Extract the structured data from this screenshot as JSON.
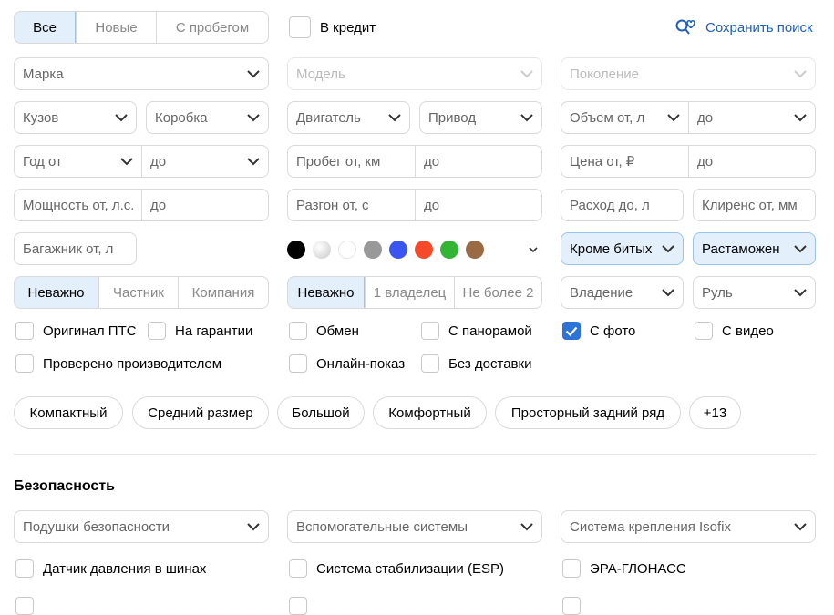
{
  "top": {
    "condition_tabs": [
      "Все",
      "Новые",
      "С пробегом"
    ],
    "credit_label": "В кредит",
    "save_search": "Сохранить поиск"
  },
  "row1": {
    "brand": "Марка",
    "model": "Модель",
    "generation": "Поколение"
  },
  "row2": {
    "body": "Кузов",
    "gearbox": "Коробка",
    "engine": "Двигатель",
    "drive": "Привод",
    "volume_from": "Объем от, л",
    "volume_to": "до"
  },
  "row3": {
    "year_from": "Год от",
    "year_to": "до",
    "mileage_from": "Пробег от, км",
    "mileage_to": "до",
    "price_from": "Цена от, ₽",
    "price_to": "до"
  },
  "row4": {
    "power_from": "Мощность от, л.с.",
    "power_to": "до",
    "accel_from": "Разгон от, с",
    "accel_to": "до",
    "consumption": "Расход до, л",
    "clearance": "Клиренс от, мм"
  },
  "row5": {
    "trunk": "Багажник от, л",
    "colors": [
      "#000000",
      "#d8d8d8",
      "#ffffff",
      "#999999",
      "#3b55f0",
      "#f44a2a",
      "#33b534",
      "#9a6a45"
    ],
    "damage": "Кроме битых",
    "customs": "Растаможен"
  },
  "row6": {
    "seller_tabs": [
      "Неважно",
      "Частник",
      "Компания"
    ],
    "owners_tabs": [
      "Неважно",
      "1 владелец",
      "Не более 2"
    ],
    "ownership": "Владение",
    "wheel": "Руль"
  },
  "checkboxes": {
    "original_pts": "Оригинал ПТС",
    "warranty": "На гарантии",
    "exchange": "Обмен",
    "panorama": "С панорамой",
    "photo": "С фото",
    "video": "С видео",
    "manufacturer_checked": "Проверено производителем",
    "online_show": "Онлайн-показ",
    "no_delivery": "Без доставки"
  },
  "chips": [
    "Компактный",
    "Средний размер",
    "Большой",
    "Комфортный",
    "Просторный задний ряд",
    "+13"
  ],
  "safety": {
    "title": "Безопасность",
    "airbags": "Подушки безопасности",
    "assist": "Вспомогательные системы",
    "isofix": "Система крепления Isofix",
    "tpms": "Датчик давления в шинах",
    "esp": "Система стабилизации (ESP)",
    "era": "ЭРА-ГЛОНАСС"
  },
  "colors": {
    "accent": "#2e74d8",
    "active_bg": "#e3effb",
    "link": "#1f5fb8"
  }
}
